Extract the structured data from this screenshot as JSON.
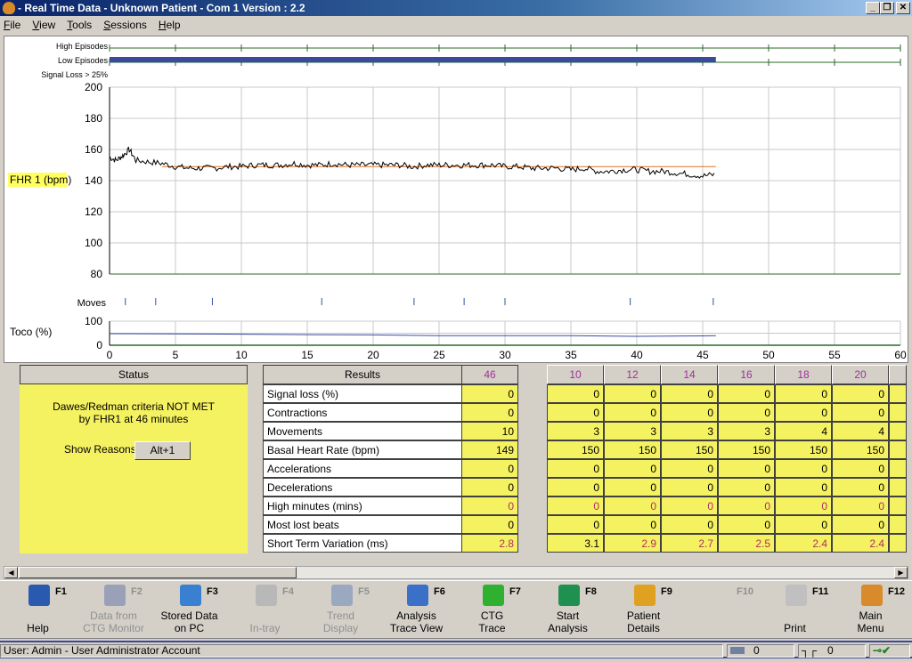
{
  "window": {
    "title": "- Real Time Data - Unknown Patient - Com 1  Version : 2.2",
    "controls": [
      "_",
      "❐",
      "✕"
    ]
  },
  "menu": [
    "File",
    "View",
    "Tools",
    "Sessions",
    "Help"
  ],
  "colors": {
    "episode_bar": "#3a4aa0",
    "fhr_trace": "#000000",
    "baseline": "#e07020",
    "grid": "#c8c8c8",
    "axis": "#2a6a2a",
    "yellow": "#f5f262",
    "fhr_label_bg": "#ffff60"
  },
  "chart_data": {
    "type": "line",
    "episode_rows": [
      "High Episodes",
      "Low Episodes",
      "Signal Loss > 25%"
    ],
    "low_episodes": [
      [
        0,
        46
      ]
    ],
    "fhr": {
      "ylabel": "FHR 1 (bpm)",
      "ylim": [
        80,
        200
      ],
      "yticks": [
        80,
        100,
        120,
        140,
        160,
        180,
        200
      ],
      "x": [
        0,
        0.5,
        1,
        1.5,
        2,
        3,
        4,
        5,
        6,
        7,
        8,
        9,
        10,
        11,
        12,
        13,
        14,
        15,
        16,
        17,
        18,
        19,
        20,
        21,
        22,
        23,
        24,
        25,
        26,
        27,
        28,
        29,
        30,
        31,
        32,
        33,
        34,
        35,
        36,
        37,
        38,
        39,
        40,
        41,
        42,
        43,
        44,
        45,
        46
      ],
      "values": [
        155,
        153,
        156,
        160,
        153,
        152,
        151,
        149,
        148,
        148,
        148,
        149,
        149,
        150,
        150,
        150,
        151,
        150,
        150,
        151,
        150,
        150,
        150,
        150,
        150,
        149,
        150,
        150,
        150,
        150,
        150,
        150,
        149,
        149,
        148,
        148,
        148,
        147,
        148,
        146,
        146,
        147,
        147,
        146,
        146,
        145,
        144,
        143,
        144
      ],
      "baseline": 149
    },
    "moves": {
      "label": "Moves",
      "times": [
        1.2,
        3.5,
        7.8,
        16.1,
        23.1,
        26.9,
        30.0,
        39.5,
        45.8
      ]
    },
    "toco": {
      "ylabel": "Toco (%)",
      "ylim": [
        0,
        100
      ],
      "yticks": [
        0,
        100
      ],
      "x": [
        0,
        5,
        10,
        15,
        20,
        25,
        30,
        35,
        40,
        45,
        46
      ],
      "values": [
        48,
        47,
        46,
        44,
        43,
        40,
        40,
        40,
        37,
        39,
        40
      ]
    },
    "xlim": [
      0,
      60
    ],
    "xticks": [
      0,
      5,
      10,
      15,
      20,
      25,
      30,
      35,
      40,
      45,
      50,
      55,
      60
    ]
  },
  "status": {
    "header": "Status",
    "line1": "Dawes/Redman criteria NOT MET",
    "line2": "by FHR1 at 46 minutes",
    "reasons_label": "Show Reasons",
    "reasons_button": "Alt+1"
  },
  "results": {
    "header": "Results",
    "current_col": "46",
    "columns": [
      "10",
      "12",
      "14",
      "16",
      "18",
      "20"
    ],
    "rows": [
      {
        "label": "Signal loss (%)",
        "current": "0",
        "values": [
          "0",
          "0",
          "0",
          "0",
          "0",
          "0"
        ]
      },
      {
        "label": "Contractions",
        "current": "0",
        "values": [
          "0",
          "0",
          "0",
          "0",
          "0",
          "0"
        ]
      },
      {
        "label": "Movements",
        "current": "10",
        "values": [
          "3",
          "3",
          "3",
          "3",
          "4",
          "4"
        ]
      },
      {
        "label": "Basal Heart Rate (bpm)",
        "current": "149",
        "values": [
          "150",
          "150",
          "150",
          "150",
          "150",
          "150"
        ]
      },
      {
        "label": "Accelerations",
        "current": "0",
        "values": [
          "0",
          "0",
          "0",
          "0",
          "0",
          "0"
        ]
      },
      {
        "label": "Decelerations",
        "current": "0",
        "values": [
          "0",
          "0",
          "0",
          "0",
          "0",
          "0"
        ]
      },
      {
        "label": "High minutes (mins)",
        "current": "0",
        "values": [
          "0",
          "0",
          "0",
          "0",
          "0",
          "0"
        ],
        "red": [
          true,
          true,
          true,
          true,
          true,
          true,
          true
        ]
      },
      {
        "label": "Most lost beats",
        "current": "0",
        "values": [
          "0",
          "0",
          "0",
          "0",
          "0",
          "0"
        ]
      },
      {
        "label": "Short Term Variation (ms)",
        "current": "2.8",
        "values": [
          "3.1",
          "2.9",
          "2.7",
          "2.5",
          "2.4",
          "2.4"
        ],
        "red": [
          true,
          false,
          true,
          true,
          true,
          true,
          true
        ]
      }
    ]
  },
  "toolbar": [
    {
      "key": "F1",
      "label": "Help",
      "icon": "help-icon",
      "color": "#2a5ab0",
      "enabled": true
    },
    {
      "key": "F2",
      "label": "Data from\nCTG Monitor",
      "icon": "ctg-monitor-icon",
      "color": "#9aa0b8",
      "enabled": false
    },
    {
      "key": "F3",
      "label": "Stored Data\non PC",
      "icon": "stored-data-icon",
      "color": "#3a80d0",
      "enabled": true
    },
    {
      "key": "F4",
      "label": "In-tray",
      "icon": "in-tray-icon",
      "color": "#b8b8b8",
      "enabled": false
    },
    {
      "key": "F5",
      "label": "Trend\nDisplay",
      "icon": "trend-display-icon",
      "color": "#9aa8c0",
      "enabled": false
    },
    {
      "key": "F6",
      "label": "Analysis\nTrace View",
      "icon": "analysis-trace-icon",
      "color": "#3a70c8",
      "enabled": true
    },
    {
      "key": "F7",
      "label": "CTG\nTrace",
      "icon": "ctg-trace-icon",
      "color": "#30b030",
      "enabled": true
    },
    {
      "key": "F8",
      "label": "Start\nAnalysis",
      "icon": "start-analysis-icon",
      "color": "#209050",
      "enabled": true
    },
    {
      "key": "F9",
      "label": "Patient\nDetails",
      "icon": "patient-details-icon",
      "color": "#e0a020",
      "enabled": true
    },
    {
      "key": "F10",
      "label": "",
      "icon": "",
      "color": "",
      "enabled": false
    },
    {
      "key": "F11",
      "label": "Print",
      "icon": "print-icon",
      "color": "#c0c0c0",
      "enabled": true
    },
    {
      "key": "F12",
      "label": "Main\nMenu",
      "icon": "main-menu-icon",
      "color": "#d98a2a",
      "enabled": true
    }
  ],
  "statusbar": {
    "user": "User: Admin - User Administrator Account",
    "count1": "0",
    "count2": "0"
  }
}
